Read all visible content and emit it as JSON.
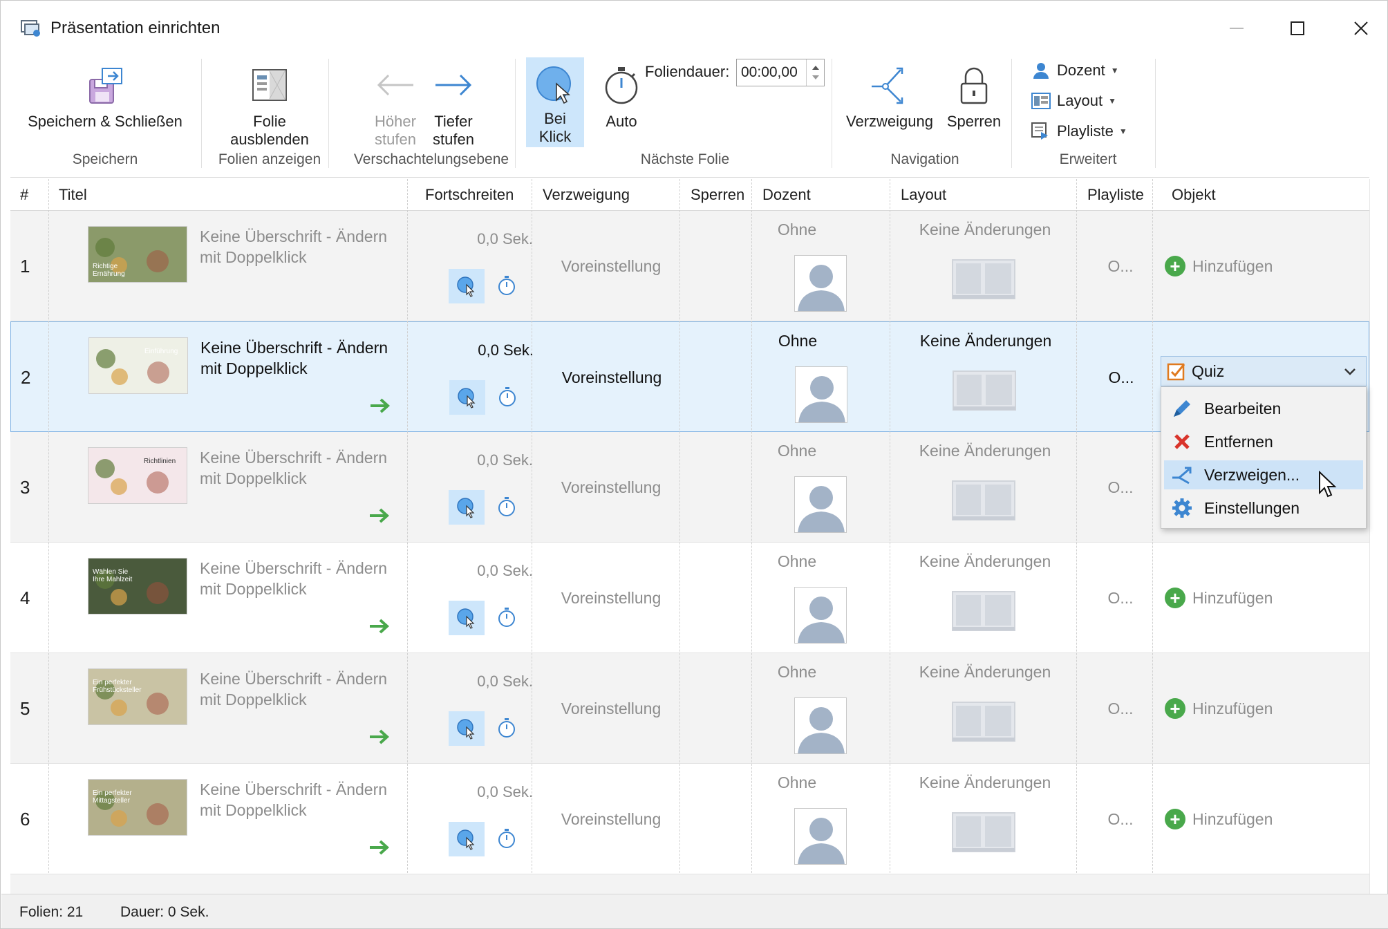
{
  "window": {
    "title": "Präsentation einrichten"
  },
  "ribbon": {
    "speichern_schliessen": "Speichern & Schließen",
    "folie_ausblenden": [
      "Folie",
      "ausblenden"
    ],
    "hoeher_stufen": [
      "Höher",
      "stufen"
    ],
    "tiefer_stufen": [
      "Tiefer",
      "stufen"
    ],
    "bei_klick": [
      "Bei",
      "Klick"
    ],
    "auto": "Auto",
    "foliendauer_label": "Foliendauer:",
    "foliendauer_value": "00:00,00",
    "verzweigung": "Verzweigung",
    "sperren": "Sperren",
    "dozent": "Dozent",
    "layout": "Layout",
    "playliste": "Playliste",
    "groups": {
      "speichern": "Speichern",
      "folien_anzeigen": "Folien anzeigen",
      "verschachtelungsebene": "Verschachtelungsebene",
      "naechste_folie": "Nächste Folie",
      "navigation": "Navigation",
      "erweitert": "Erweitert"
    }
  },
  "columns": [
    "#",
    "Titel",
    "Fortschreiten",
    "Verzweigung",
    "Sperren",
    "Dozent",
    "Layout",
    "Playliste",
    "Objekt"
  ],
  "rows": [
    {
      "num": "1",
      "title": [
        "Keine Überschrift - Ändern",
        "mit Doppelklick"
      ],
      "duration": "0,0 Sek.",
      "branch": "Voreinstellung",
      "dozent": "Ohne",
      "layout": "Keine Änderungen",
      "playlist": "O...",
      "object": "Hinzufügen",
      "thumb_text": "Richtige Ernährung"
    },
    {
      "num": "2",
      "title": [
        "Keine Überschrift - Ändern",
        "mit Doppelklick"
      ],
      "duration": "0,0 Sek.",
      "branch": "Voreinstellung",
      "dozent": "Ohne",
      "layout": "Keine Änderungen",
      "playlist": "O...",
      "object": "Quiz",
      "thumb_text": "Einführung"
    },
    {
      "num": "3",
      "title": [
        "Keine Überschrift - Ändern",
        "mit Doppelklick"
      ],
      "duration": "0,0 Sek.",
      "branch": "Voreinstellung",
      "dozent": "Ohne",
      "layout": "Keine Änderungen",
      "playlist": "O...",
      "object": "",
      "thumb_text": "Richtlinien"
    },
    {
      "num": "4",
      "title": [
        "Keine Überschrift - Ändern",
        "mit Doppelklick"
      ],
      "duration": "0,0 Sek.",
      "branch": "Voreinstellung",
      "dozent": "Ohne",
      "layout": "Keine Änderungen",
      "playlist": "O...",
      "object": "Hinzufügen",
      "thumb_text": "Wählen Sie Ihre Mahlzeit"
    },
    {
      "num": "5",
      "title": [
        "Keine Überschrift - Ändern",
        "mit Doppelklick"
      ],
      "duration": "0,0 Sek.",
      "branch": "Voreinstellung",
      "dozent": "Ohne",
      "layout": "Keine Änderungen",
      "playlist": "O...",
      "object": "Hinzufügen",
      "thumb_text": "Ein perfekter Frühstücksteller"
    },
    {
      "num": "6",
      "title": [
        "Keine Überschrift - Ändern",
        "mit Doppelklick"
      ],
      "duration": "0,0 Sek.",
      "branch": "Voreinstellung",
      "dozent": "Ohne",
      "layout": "Keine Änderungen",
      "playlist": "O...",
      "object": "Hinzufügen",
      "thumb_text": "Ein perfekter Mittagsteller"
    }
  ],
  "context_menu": [
    "Bearbeiten",
    "Entfernen",
    "Verzweigen...",
    "Einstellungen"
  ],
  "status": {
    "folien": "Folien: 21",
    "dauer": "Dauer:  0 Sek."
  },
  "colors": {
    "accent": "#3d86d1",
    "selected_row": "#e5f2fc",
    "selected_button": "#cde6fb",
    "green": "#49a84b",
    "red": "#d9342b"
  }
}
